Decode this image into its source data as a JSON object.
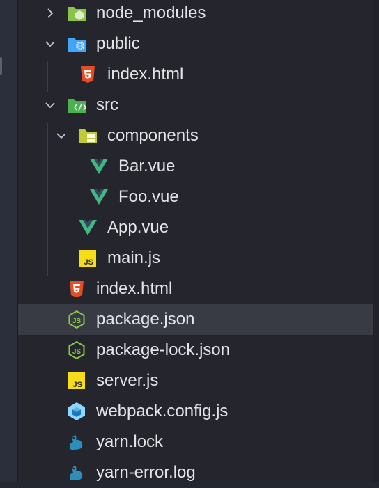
{
  "explorer": {
    "items": [
      {
        "label": "node_modules",
        "icon": "folder-node-icon",
        "kind": "folder",
        "expanded": false
      },
      {
        "label": "public",
        "icon": "folder-public-icon",
        "kind": "folder",
        "expanded": true
      },
      {
        "label": "index.html",
        "icon": "html5-icon",
        "kind": "file"
      },
      {
        "label": "src",
        "icon": "folder-src-icon",
        "kind": "folder",
        "expanded": true
      },
      {
        "label": "components",
        "icon": "folder-components-icon",
        "kind": "folder",
        "expanded": true
      },
      {
        "label": "Bar.vue",
        "icon": "vue-icon",
        "kind": "file"
      },
      {
        "label": "Foo.vue",
        "icon": "vue-icon",
        "kind": "file"
      },
      {
        "label": "App.vue",
        "icon": "vue-icon",
        "kind": "file"
      },
      {
        "label": "main.js",
        "icon": "javascript-icon",
        "kind": "file"
      },
      {
        "label": "index.html",
        "icon": "html5-icon",
        "kind": "file"
      },
      {
        "label": "package.json",
        "icon": "nodejs-icon",
        "kind": "file",
        "selected": true
      },
      {
        "label": "package-lock.json",
        "icon": "nodejs-icon",
        "kind": "file"
      },
      {
        "label": "server.js",
        "icon": "javascript-icon",
        "kind": "file"
      },
      {
        "label": "webpack.config.js",
        "icon": "webpack-icon",
        "kind": "file"
      },
      {
        "label": "yarn.lock",
        "icon": "yarn-icon",
        "kind": "file"
      },
      {
        "label": "yarn-error.log",
        "icon": "yarn-icon",
        "kind": "file"
      }
    ]
  },
  "colors": {
    "background": "#25262d",
    "selected_row": "#393b44",
    "text": "#e3e4e8",
    "folder_green": "#8bc34a",
    "folder_blue": "#42a5f5",
    "html_orange": "#e44d26",
    "vue_green": "#41b883",
    "js_yellow": "#f5de19",
    "node_green": "#8cc84b",
    "webpack_blue": "#8ed6fb",
    "yarn_blue": "#2c8ebb"
  }
}
